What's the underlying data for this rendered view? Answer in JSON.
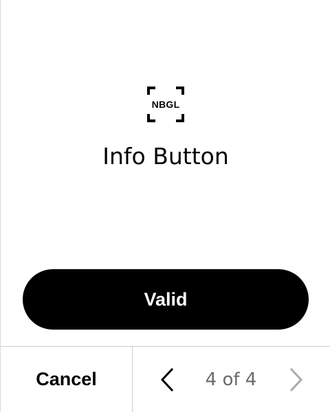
{
  "logo": {
    "icon": "nbgl-frame-icon",
    "text": "NBGL"
  },
  "title": "Info Button",
  "valid_button": {
    "label": "Valid"
  },
  "footer": {
    "cancel_label": "Cancel",
    "page_indicator": "4 of 4",
    "prev_icon": "chevron-left-icon",
    "next_icon": "chevron-right-icon",
    "next_enabled": false
  },
  "colors": {
    "primary": "#000000",
    "background": "#ffffff",
    "muted": "#6a6a6a",
    "divider": "#cccccc"
  }
}
